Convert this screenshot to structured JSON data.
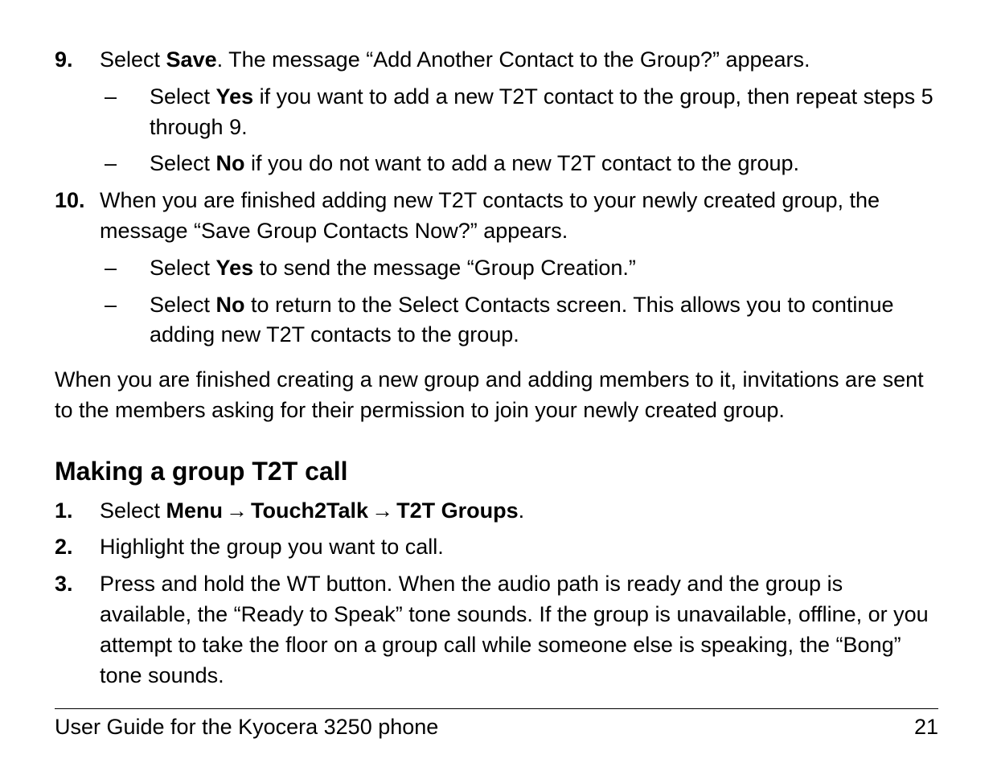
{
  "step9": {
    "num": "9.",
    "text_before": "Select ",
    "bold": "Save",
    "text_after": ". The message “Add Another Contact to the Group?” appears.",
    "sub": [
      {
        "before": "Select ",
        "bold": "Yes",
        "after": " if you want to add a new T2T contact to the group, then repeat steps 5 through 9."
      },
      {
        "before": "Select ",
        "bold": "No",
        "after": " if you do not want to add a new T2T contact to the group."
      }
    ]
  },
  "step10": {
    "num": "10.",
    "text": "When you are finished adding new T2T contacts to your newly created group, the message “Save Group Contacts Now?” appears.",
    "sub": [
      {
        "before": "Select ",
        "bold": "Yes",
        "after": " to send the message “Group Creation.”"
      },
      {
        "before": "Select ",
        "bold": "No",
        "after": " to return to the Select Contacts screen. This allows you to continue adding new T2T contacts to the group."
      }
    ]
  },
  "closing_para": "When you are finished creating a new group and adding members to it, invitations are sent to the members asking for their permission to join your newly created group.",
  "heading": "Making a group T2T call",
  "call_steps": {
    "s1": {
      "num": "1.",
      "before": "Select ",
      "b1": "Menu",
      "b2": "Touch2Talk",
      "b3": "T2T Groups",
      "after": "."
    },
    "s2": {
      "num": "2.",
      "text": "Highlight the group you want to call."
    },
    "s3": {
      "num": "3.",
      "text": "Press and hold the WT button. When the audio path is ready and the group is available, the “Ready to Speak” tone sounds. If the group is unavailable, offline, or you attempt to take the floor on a group call while someone else is speaking, the “Bong” tone sounds."
    }
  },
  "arrow": "→",
  "dash": "–",
  "footer": {
    "title": "User Guide for the Kyocera 3250 phone",
    "page": "21"
  }
}
